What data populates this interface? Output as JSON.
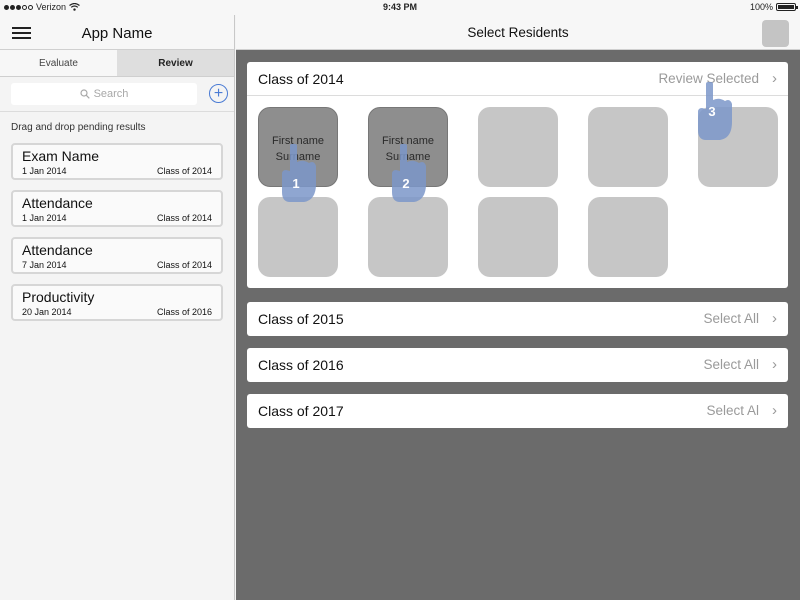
{
  "statusbar": {
    "carrier": "Verizon",
    "time": "9:43 PM",
    "battery_text": "100%",
    "battery_level": 1.0
  },
  "left": {
    "app_name": "App Name",
    "tabs": [
      {
        "label": "Evaluate",
        "active": false
      },
      {
        "label": "Review",
        "active": true
      }
    ],
    "search_placeholder": "Search",
    "drag_hint": "Drag and drop pending results",
    "results": [
      {
        "name": "Exam Name",
        "date": "1 Jan 2014",
        "class": "Class of 2014"
      },
      {
        "name": "Attendance",
        "date": "1 Jan 2014",
        "class": "Class of 2014"
      },
      {
        "name": "Attendance",
        "date": "7 Jan 2014",
        "class": "Class of 2014"
      },
      {
        "name": "Productivity",
        "date": "20 Jan 2014",
        "class": "Class of 2016"
      }
    ]
  },
  "right": {
    "title": "Select Residents",
    "classes": [
      {
        "label": "Class of 2014",
        "action": "Review Selected",
        "residents": [
          {
            "first": "First name",
            "last": "Surname",
            "selected": true
          },
          {
            "first": "First name",
            "last": "Surname",
            "selected": true
          },
          {
            "first": "",
            "last": "",
            "selected": false
          },
          {
            "first": "",
            "last": "",
            "selected": false
          },
          {
            "first": "",
            "last": "",
            "selected": false
          },
          {
            "first": "",
            "last": "",
            "selected": false
          },
          {
            "first": "",
            "last": "",
            "selected": false
          },
          {
            "first": "",
            "last": "",
            "selected": false
          },
          {
            "first": "",
            "last": "",
            "selected": false
          }
        ]
      },
      {
        "label": "Class of 2015",
        "action": "Select All"
      },
      {
        "label": "Class of 2016",
        "action": "Select All"
      },
      {
        "label": "Class of 2017",
        "action": "Select Al"
      }
    ],
    "gestures": [
      "1",
      "2",
      "3"
    ]
  },
  "colors": {
    "accent": "#4a7bd4",
    "hand": "#7b96c9",
    "panel_bg": "#6b6b6b",
    "tile": "#c6c6c6",
    "tile_selected": "#8e8e8e"
  },
  "icons": {
    "menu": "hamburger-icon",
    "search": "search-icon",
    "add": "plus-circle-icon",
    "chevron": "chevron-right-icon",
    "gesture": "tap-hand-icon",
    "wifi": "wifi-icon",
    "battery": "battery-icon"
  }
}
